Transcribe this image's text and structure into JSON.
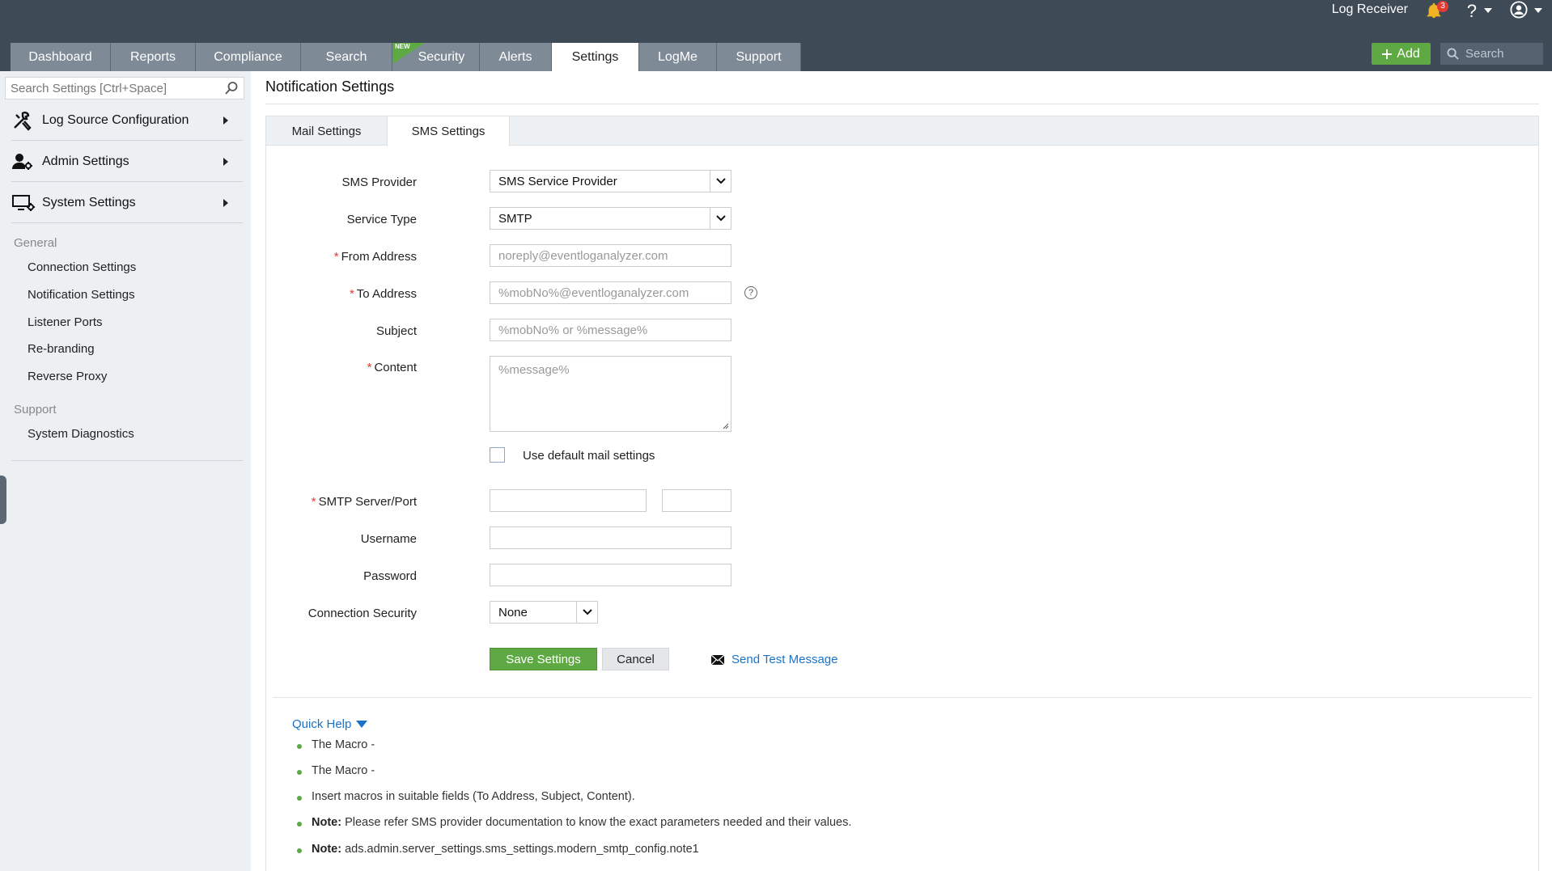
{
  "header": {
    "app_label": "Log Receiver",
    "notification_count": "3",
    "help_label": "?",
    "nav_tabs": [
      {
        "label": "Dashboard"
      },
      {
        "label": "Reports"
      },
      {
        "label": "Compliance"
      },
      {
        "label": "Search"
      },
      {
        "label": "Security",
        "badge": "NEW"
      },
      {
        "label": "Alerts"
      },
      {
        "label": "Settings",
        "active": true
      },
      {
        "label": "LogMe"
      },
      {
        "label": "Support"
      }
    ],
    "add_label": "Add",
    "search_placeholder": "Search"
  },
  "sidebar": {
    "search_placeholder": "Search Settings [Ctrl+Space]",
    "sections": [
      {
        "label": "Log Source Configuration",
        "icon": "tools-icon"
      },
      {
        "label": "Admin Settings",
        "icon": "admin-user-icon"
      },
      {
        "label": "System Settings",
        "icon": "system-settings-icon"
      }
    ],
    "groups": [
      {
        "title": "General",
        "items": [
          "Connection Settings",
          "Notification Settings",
          "Listener Ports",
          "Re-branding",
          "Reverse Proxy"
        ]
      },
      {
        "title": "Support",
        "items": [
          "System Diagnostics"
        ]
      }
    ]
  },
  "main": {
    "title": "Notification Settings",
    "tabs": [
      {
        "label": "Mail Settings"
      },
      {
        "label": "SMS Settings",
        "active": true
      }
    ],
    "form": {
      "sms_provider": {
        "label": "SMS Provider",
        "value": "SMS Service Provider"
      },
      "service_type": {
        "label": "Service Type",
        "value": "SMTP"
      },
      "from_address": {
        "label": "From Address",
        "required": "*",
        "placeholder": "noreply@eventloganalyzer.com"
      },
      "to_address": {
        "label": "To Address",
        "required": "*",
        "placeholder": "%mobNo%@eventloganalyzer.com"
      },
      "subject": {
        "label": "Subject",
        "placeholder": "%mobNo% or %message%"
      },
      "content": {
        "label": "Content",
        "required": "*",
        "placeholder": "%message%"
      },
      "use_default_mail": {
        "label": "Use default mail settings",
        "checked": false
      },
      "smtp_server_port": {
        "label": "SMTP Server/Port",
        "required": "*"
      },
      "username": {
        "label": "Username"
      },
      "password": {
        "label": "Password"
      },
      "connection_security": {
        "label": "Connection Security",
        "value": "None"
      }
    },
    "buttons": {
      "save": "Save Settings",
      "cancel": "Cancel",
      "test": "Send Test Message"
    },
    "quick_help": {
      "title": "Quick Help",
      "items": [
        {
          "prefix": "",
          "text": "The Macro -"
        },
        {
          "prefix": "",
          "text": "The Macro -"
        },
        {
          "prefix": "",
          "text": "Insert macros in suitable fields (To Address, Subject, Content)."
        },
        {
          "prefix": "Note:",
          "text": "Please refer SMS provider documentation to know the exact parameters needed and their values."
        },
        {
          "prefix": "Note:",
          "text": "ads.admin.server_settings.sms_settings.modern_smtp_config.note1"
        }
      ]
    }
  },
  "colors": {
    "topbar": "#3e4a56",
    "nav_tab": "#7e8a96",
    "accent_green": "#5ea943",
    "link_blue": "#1a73c8",
    "required_red": "#e53935",
    "sidebar_bg": "#edf0f2"
  }
}
